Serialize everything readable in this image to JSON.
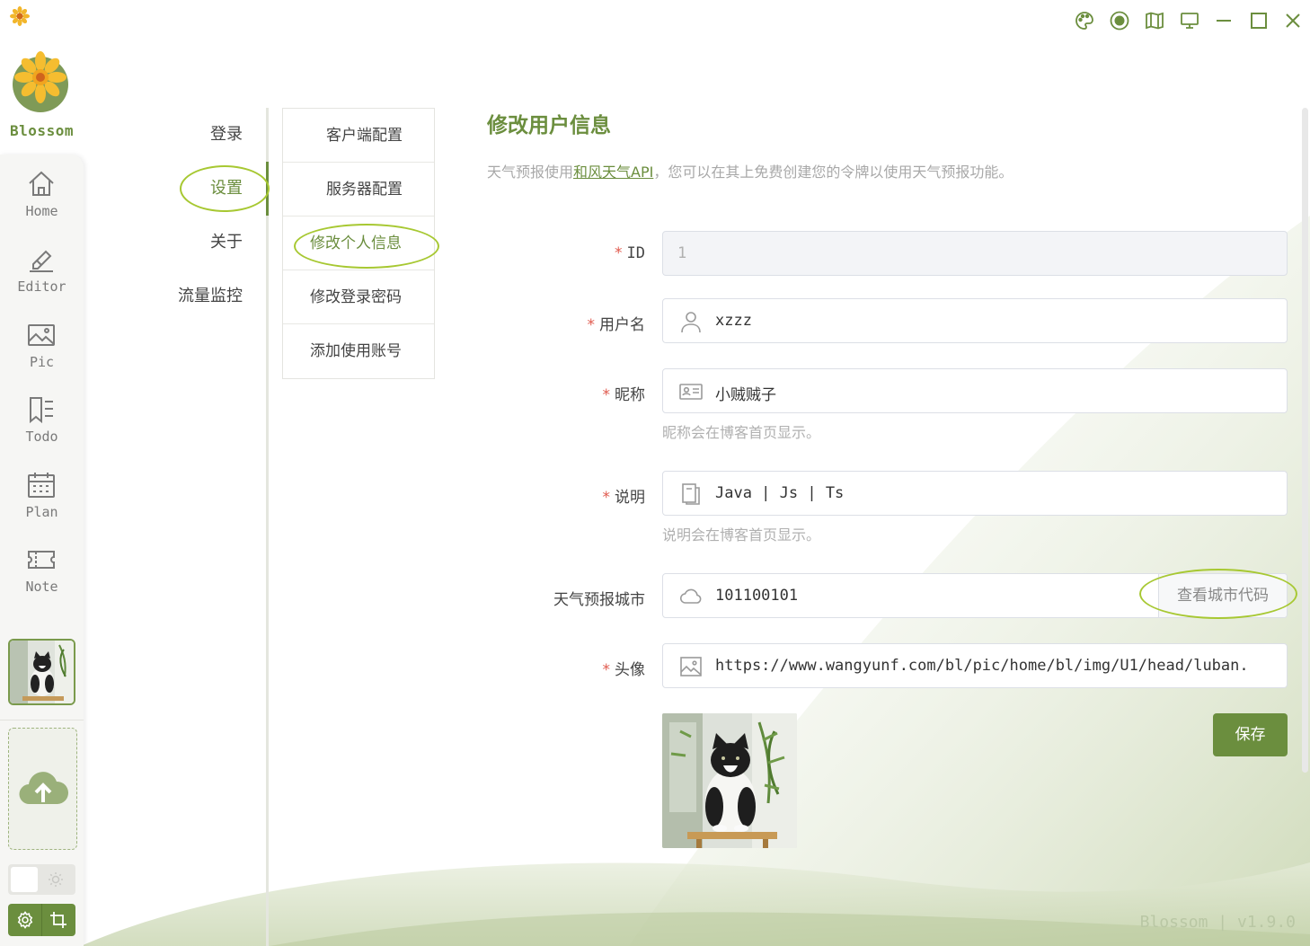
{
  "app": {
    "name": "Blossom",
    "version": "Blossom | v1.9.0"
  },
  "window_controls": [
    "palette-icon",
    "record-icon",
    "book-icon",
    "monitor-icon",
    "minimize-icon",
    "maximize-icon",
    "close-icon"
  ],
  "sidebar": {
    "items": [
      {
        "label": "Home",
        "icon": "home-icon"
      },
      {
        "label": "Editor",
        "icon": "editor-icon"
      },
      {
        "label": "Pic",
        "icon": "picture-icon"
      },
      {
        "label": "Todo",
        "icon": "todo-icon"
      },
      {
        "label": "Plan",
        "icon": "calendar-icon"
      },
      {
        "label": "Note",
        "icon": "ticket-icon"
      }
    ]
  },
  "settings_nav": {
    "items": [
      "登录",
      "设置",
      "关于",
      "流量监控"
    ],
    "active": "设置"
  },
  "sub_nav": {
    "items": [
      "客户端配置",
      "服务器配置",
      "修改个人信息",
      "修改登录密码",
      "添加使用账号"
    ],
    "active": "修改个人信息"
  },
  "form": {
    "title": "修改用户信息",
    "desc_prefix": "天气预报使用",
    "desc_link": "和风天气API",
    "desc_suffix": "，您可以在其上免费创建您的令牌以使用天气预报功能。",
    "fields": {
      "id": {
        "label": "ID",
        "value": "1",
        "required": true
      },
      "username": {
        "label": "用户名",
        "value": "xzzz",
        "required": true
      },
      "nickname": {
        "label": "昵称",
        "value": "小贼贼子",
        "required": true,
        "hint": "昵称会在博客首页显示。"
      },
      "remark": {
        "label": "说明",
        "value": "Java | Js | Ts",
        "required": true,
        "hint": "说明会在博客首页显示。"
      },
      "city": {
        "label": "天气预报城市",
        "value": "101100101",
        "button": "查看城市代码"
      },
      "avatar": {
        "label": "头像",
        "value": "https://www.wangyunf.com/bl/pic/home/bl/img/U1/head/luban.",
        "required": true
      }
    },
    "save_label": "保存"
  },
  "colors": {
    "accent": "#6b8e3e",
    "highlight": "#a7c832",
    "required": "#e05a4e"
  }
}
